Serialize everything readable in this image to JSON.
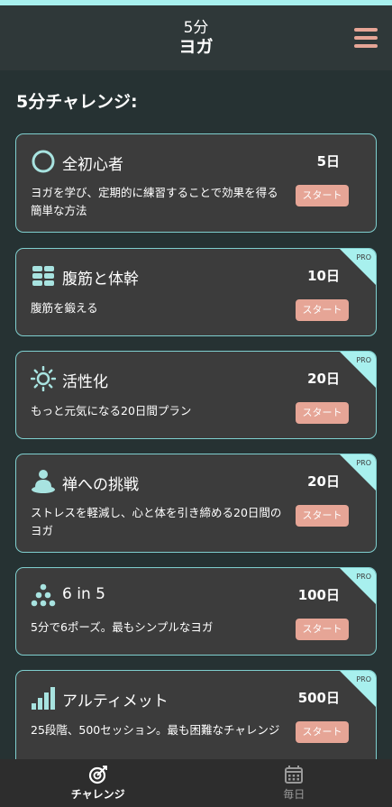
{
  "header": {
    "title_line1": "5分",
    "title_line2": "ヨガ"
  },
  "section_title": "5分チャレンジ:",
  "start_label": "スタート",
  "pro_label": "PRO",
  "challenges": [
    {
      "title": "全初心者",
      "days": "5日",
      "description": "ヨガを学び、定期的に練習することで効果を得る簡単な方法",
      "pro": false,
      "icon": "circle-icon"
    },
    {
      "title": "腹筋と体幹",
      "days": "10日",
      "description": "腹筋を鍛える",
      "pro": true,
      "icon": "abs-icon"
    },
    {
      "title": "活性化",
      "days": "20日",
      "description": "もっと元気になる20日間プラン",
      "pro": true,
      "icon": "sun-icon"
    },
    {
      "title": "禅への挑戦",
      "days": "20日",
      "description": "ストレスを軽減し、心と体を引き締める20日間のヨガ",
      "pro": true,
      "icon": "meditation-icon"
    },
    {
      "title": "6 in 5",
      "days": "100日",
      "description": "5分で6ポーズ。最もシンプルなヨガ",
      "pro": true,
      "icon": "dots-pyramid-icon"
    },
    {
      "title": "アルティメット",
      "days": "500日",
      "description": "25段階、500セッション。最も困難なチャレンジ",
      "pro": true,
      "icon": "bar-chart-icon"
    }
  ],
  "nav": {
    "challenge": "チャレンジ",
    "daily": "毎日"
  },
  "colors": {
    "accent": "#e6a596",
    "teal": "#a8f0ee",
    "icon": "#a8e3e0"
  }
}
